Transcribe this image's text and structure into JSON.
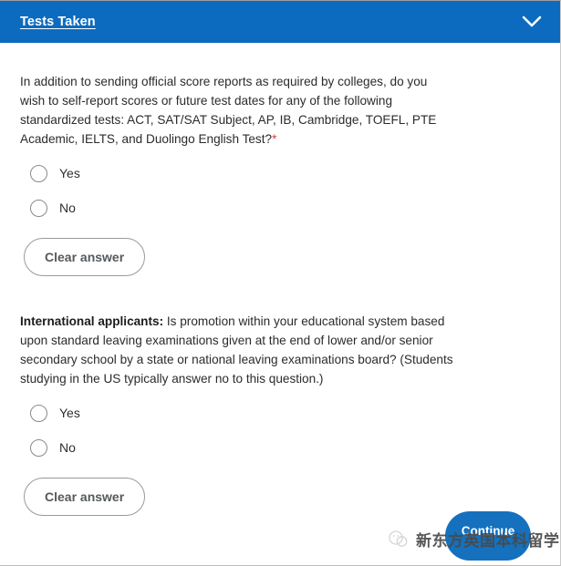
{
  "section": {
    "header_title": "Tests Taken",
    "chevron_icon": "chevron-down-icon",
    "header_color": "#0c6bbf"
  },
  "questions": [
    {
      "id": "self-report-scores",
      "text_plain": "In addition to sending official score reports as required by colleges, do you wish to self-report scores or future test dates for any of the following standardized tests: ACT, SAT/SAT Subject, AP, IB, Cambridge, TOEFL, PTE Academic, IELTS, and Duolingo English Test?",
      "required_marker": "*",
      "required_marker_color": "#e03b3b",
      "options": [
        {
          "label": "Yes",
          "selected": false
        },
        {
          "label": "No",
          "selected": false
        }
      ],
      "clear_label": "Clear answer"
    },
    {
      "id": "international-applicants-promotion",
      "lead_bold": "International applicants:",
      "text_plain": " Is promotion within your educational system based upon standard leaving examinations given at the end of lower and/or senior secondary school by a state or national leaving examinations board? (Students studying in the US typically answer no to this question.)",
      "options": [
        {
          "label": "Yes",
          "selected": false
        },
        {
          "label": "No",
          "selected": false
        }
      ],
      "clear_label": "Clear answer"
    }
  ],
  "footer": {
    "continue_label": "Continue",
    "continue_color": "#1570bd"
  },
  "watermark": {
    "text": "新东方英国本科留学",
    "logo_icon": "wechat-account-logo-icon"
  }
}
